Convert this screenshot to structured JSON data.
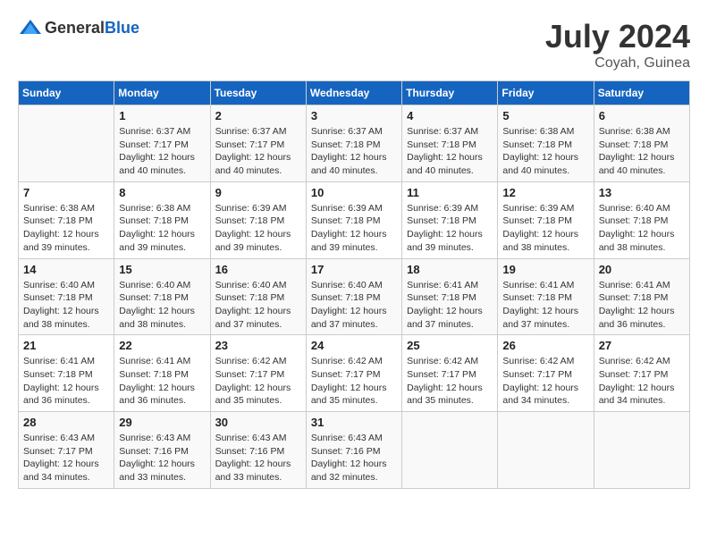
{
  "header": {
    "logo_general": "General",
    "logo_blue": "Blue",
    "month_year": "July 2024",
    "location": "Coyah, Guinea"
  },
  "days_of_week": [
    "Sunday",
    "Monday",
    "Tuesday",
    "Wednesday",
    "Thursday",
    "Friday",
    "Saturday"
  ],
  "weeks": [
    [
      {
        "day": "",
        "sunrise": "",
        "sunset": "",
        "daylight": ""
      },
      {
        "day": "1",
        "sunrise": "Sunrise: 6:37 AM",
        "sunset": "Sunset: 7:17 PM",
        "daylight": "Daylight: 12 hours and 40 minutes."
      },
      {
        "day": "2",
        "sunrise": "Sunrise: 6:37 AM",
        "sunset": "Sunset: 7:17 PM",
        "daylight": "Daylight: 12 hours and 40 minutes."
      },
      {
        "day": "3",
        "sunrise": "Sunrise: 6:37 AM",
        "sunset": "Sunset: 7:18 PM",
        "daylight": "Daylight: 12 hours and 40 minutes."
      },
      {
        "day": "4",
        "sunrise": "Sunrise: 6:37 AM",
        "sunset": "Sunset: 7:18 PM",
        "daylight": "Daylight: 12 hours and 40 minutes."
      },
      {
        "day": "5",
        "sunrise": "Sunrise: 6:38 AM",
        "sunset": "Sunset: 7:18 PM",
        "daylight": "Daylight: 12 hours and 40 minutes."
      },
      {
        "day": "6",
        "sunrise": "Sunrise: 6:38 AM",
        "sunset": "Sunset: 7:18 PM",
        "daylight": "Daylight: 12 hours and 40 minutes."
      }
    ],
    [
      {
        "day": "7",
        "sunrise": "Sunrise: 6:38 AM",
        "sunset": "Sunset: 7:18 PM",
        "daylight": "Daylight: 12 hours and 39 minutes."
      },
      {
        "day": "8",
        "sunrise": "Sunrise: 6:38 AM",
        "sunset": "Sunset: 7:18 PM",
        "daylight": "Daylight: 12 hours and 39 minutes."
      },
      {
        "day": "9",
        "sunrise": "Sunrise: 6:39 AM",
        "sunset": "Sunset: 7:18 PM",
        "daylight": "Daylight: 12 hours and 39 minutes."
      },
      {
        "day": "10",
        "sunrise": "Sunrise: 6:39 AM",
        "sunset": "Sunset: 7:18 PM",
        "daylight": "Daylight: 12 hours and 39 minutes."
      },
      {
        "day": "11",
        "sunrise": "Sunrise: 6:39 AM",
        "sunset": "Sunset: 7:18 PM",
        "daylight": "Daylight: 12 hours and 39 minutes."
      },
      {
        "day": "12",
        "sunrise": "Sunrise: 6:39 AM",
        "sunset": "Sunset: 7:18 PM",
        "daylight": "Daylight: 12 hours and 38 minutes."
      },
      {
        "day": "13",
        "sunrise": "Sunrise: 6:40 AM",
        "sunset": "Sunset: 7:18 PM",
        "daylight": "Daylight: 12 hours and 38 minutes."
      }
    ],
    [
      {
        "day": "14",
        "sunrise": "Sunrise: 6:40 AM",
        "sunset": "Sunset: 7:18 PM",
        "daylight": "Daylight: 12 hours and 38 minutes."
      },
      {
        "day": "15",
        "sunrise": "Sunrise: 6:40 AM",
        "sunset": "Sunset: 7:18 PM",
        "daylight": "Daylight: 12 hours and 38 minutes."
      },
      {
        "day": "16",
        "sunrise": "Sunrise: 6:40 AM",
        "sunset": "Sunset: 7:18 PM",
        "daylight": "Daylight: 12 hours and 37 minutes."
      },
      {
        "day": "17",
        "sunrise": "Sunrise: 6:40 AM",
        "sunset": "Sunset: 7:18 PM",
        "daylight": "Daylight: 12 hours and 37 minutes."
      },
      {
        "day": "18",
        "sunrise": "Sunrise: 6:41 AM",
        "sunset": "Sunset: 7:18 PM",
        "daylight": "Daylight: 12 hours and 37 minutes."
      },
      {
        "day": "19",
        "sunrise": "Sunrise: 6:41 AM",
        "sunset": "Sunset: 7:18 PM",
        "daylight": "Daylight: 12 hours and 37 minutes."
      },
      {
        "day": "20",
        "sunrise": "Sunrise: 6:41 AM",
        "sunset": "Sunset: 7:18 PM",
        "daylight": "Daylight: 12 hours and 36 minutes."
      }
    ],
    [
      {
        "day": "21",
        "sunrise": "Sunrise: 6:41 AM",
        "sunset": "Sunset: 7:18 PM",
        "daylight": "Daylight: 12 hours and 36 minutes."
      },
      {
        "day": "22",
        "sunrise": "Sunrise: 6:41 AM",
        "sunset": "Sunset: 7:18 PM",
        "daylight": "Daylight: 12 hours and 36 minutes."
      },
      {
        "day": "23",
        "sunrise": "Sunrise: 6:42 AM",
        "sunset": "Sunset: 7:17 PM",
        "daylight": "Daylight: 12 hours and 35 minutes."
      },
      {
        "day": "24",
        "sunrise": "Sunrise: 6:42 AM",
        "sunset": "Sunset: 7:17 PM",
        "daylight": "Daylight: 12 hours and 35 minutes."
      },
      {
        "day": "25",
        "sunrise": "Sunrise: 6:42 AM",
        "sunset": "Sunset: 7:17 PM",
        "daylight": "Daylight: 12 hours and 35 minutes."
      },
      {
        "day": "26",
        "sunrise": "Sunrise: 6:42 AM",
        "sunset": "Sunset: 7:17 PM",
        "daylight": "Daylight: 12 hours and 34 minutes."
      },
      {
        "day": "27",
        "sunrise": "Sunrise: 6:42 AM",
        "sunset": "Sunset: 7:17 PM",
        "daylight": "Daylight: 12 hours and 34 minutes."
      }
    ],
    [
      {
        "day": "28",
        "sunrise": "Sunrise: 6:43 AM",
        "sunset": "Sunset: 7:17 PM",
        "daylight": "Daylight: 12 hours and 34 minutes."
      },
      {
        "day": "29",
        "sunrise": "Sunrise: 6:43 AM",
        "sunset": "Sunset: 7:16 PM",
        "daylight": "Daylight: 12 hours and 33 minutes."
      },
      {
        "day": "30",
        "sunrise": "Sunrise: 6:43 AM",
        "sunset": "Sunset: 7:16 PM",
        "daylight": "Daylight: 12 hours and 33 minutes."
      },
      {
        "day": "31",
        "sunrise": "Sunrise: 6:43 AM",
        "sunset": "Sunset: 7:16 PM",
        "daylight": "Daylight: 12 hours and 32 minutes."
      },
      {
        "day": "",
        "sunrise": "",
        "sunset": "",
        "daylight": ""
      },
      {
        "day": "",
        "sunrise": "",
        "sunset": "",
        "daylight": ""
      },
      {
        "day": "",
        "sunrise": "",
        "sunset": "",
        "daylight": ""
      }
    ]
  ]
}
